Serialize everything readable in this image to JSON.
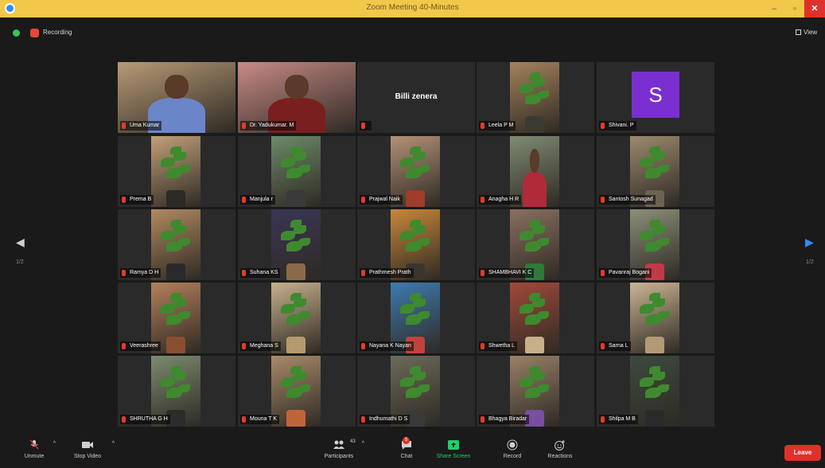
{
  "window": {
    "title": "Zoom Meeting 40-Minutes",
    "minimize": "–",
    "maximize": "▫",
    "close": "✕"
  },
  "topbar": {
    "recording_label": "Recording",
    "view_label": "View"
  },
  "nav": {
    "left_arrow": "◀",
    "right_arrow": "▶",
    "left_page": "1/2",
    "right_page": "1/2"
  },
  "participants": [
    {
      "name": "Uma Kumar",
      "type": "photo",
      "bg": "#b89a76",
      "subject": "person",
      "body": "#6a86c9",
      "active": true
    },
    {
      "name": "Dr. Yadukumar. M",
      "type": "photo",
      "bg": "#c88a86",
      "subject": "person",
      "body": "#7a1f1f"
    },
    {
      "name": "",
      "type": "text",
      "display": "Billi zenera"
    },
    {
      "name": "Leela P M",
      "type": "photo",
      "bg": "#a5825c",
      "subject": "plant",
      "pot": "#3d3a32"
    },
    {
      "name": "Shivani. P",
      "type": "avatar",
      "initial": "S"
    },
    {
      "name": "Prema B",
      "type": "photo",
      "bg": "#c2a07a",
      "subject": "plant",
      "pot": "#2c2a26"
    },
    {
      "name": "Manjula r",
      "type": "photo",
      "bg": "#6d8a6a",
      "subject": "plant",
      "pot": "#3a3a3a"
    },
    {
      "name": "Prajwal Naik",
      "type": "photo",
      "bg": "#b49178",
      "subject": "plant",
      "pot": "#a03c2a"
    },
    {
      "name": "Anagha H R",
      "type": "photo",
      "bg": "#7f8c73",
      "subject": "person",
      "body": "#b02a3a"
    },
    {
      "name": "Santosh Sunagad",
      "type": "photo",
      "bg": "#9c8a6e",
      "subject": "plant",
      "pot": "#6e6352"
    },
    {
      "name": "Ramya D H",
      "type": "photo",
      "bg": "#b08a60",
      "subject": "plant",
      "pot": "#2a2a2a"
    },
    {
      "name": "Suhana KS",
      "type": "photo",
      "bg": "#3b3557",
      "subject": "plant",
      "pot": "#8a6a48"
    },
    {
      "name": "Prathmesh Prath",
      "type": "photo",
      "bg": "#c8873a",
      "subject": "plant",
      "pot": "#3b3530"
    },
    {
      "name": "SHAMBHAVI K C",
      "type": "photo",
      "bg": "#8a7060",
      "subject": "plant",
      "pot": "#2f7a3a"
    },
    {
      "name": "Pavanraj Bogani",
      "type": "photo",
      "bg": "#8c8f7a",
      "subject": "plant",
      "pot": "#c23a4a"
    },
    {
      "name": "Veerashree",
      "type": "photo",
      "bg": "#b4805c",
      "subject": "plant",
      "pot": "#8a4f30"
    },
    {
      "name": "Meghana S",
      "type": "photo",
      "bg": "#c7b08c",
      "subject": "plant",
      "pot": "#b59a70"
    },
    {
      "name": "Nayana K Nayan",
      "type": "photo",
      "bg": "#3e7bb0",
      "subject": "plant",
      "pot": "#c0443a"
    },
    {
      "name": "Shwetha L",
      "type": "photo",
      "bg": "#a04a3a",
      "subject": "plant",
      "pot": "#c6b088"
    },
    {
      "name": "Sarna L",
      "type": "photo",
      "bg": "#cbb494",
      "subject": "plant",
      "pot": "#b39a76"
    },
    {
      "name": "SHRUTHA G H",
      "type": "photo",
      "bg": "#7c8a70",
      "subject": "plant",
      "pot": "#2c2c2c"
    },
    {
      "name": "Mouna T K",
      "type": "photo",
      "bg": "#a98a6a",
      "subject": "plant",
      "pot": "#c2643a"
    },
    {
      "name": "Indhumathi D S",
      "type": "photo",
      "bg": "#6c6a5a",
      "subject": "plant",
      "pot": "#3a3a3a"
    },
    {
      "name": "Bhagya Biradar",
      "type": "photo",
      "bg": "#9a8068",
      "subject": "plant",
      "pot": "#7a4fa0"
    },
    {
      "name": "Shilpa M B",
      "type": "photo",
      "bg": "#3d4a40",
      "subject": "plant",
      "pot": "#2a2a2a"
    }
  ],
  "toolbar": {
    "unmute": "Unmute",
    "stop_video": "Stop Video",
    "participants": "Participants",
    "participants_count": "43",
    "chat": "Chat",
    "chat_badge": "5",
    "share_screen": "Share Screen",
    "record": "Record",
    "reactions": "Reactions",
    "leave": "Leave"
  },
  "colors": {
    "titlebar": "#f2c84a",
    "background": "#1a1a1a",
    "active_speaker_border": "#d9e23f",
    "share_green": "#1fcf6c",
    "leave_red": "#e0302a",
    "avatar_purple": "#7a2fd0"
  }
}
